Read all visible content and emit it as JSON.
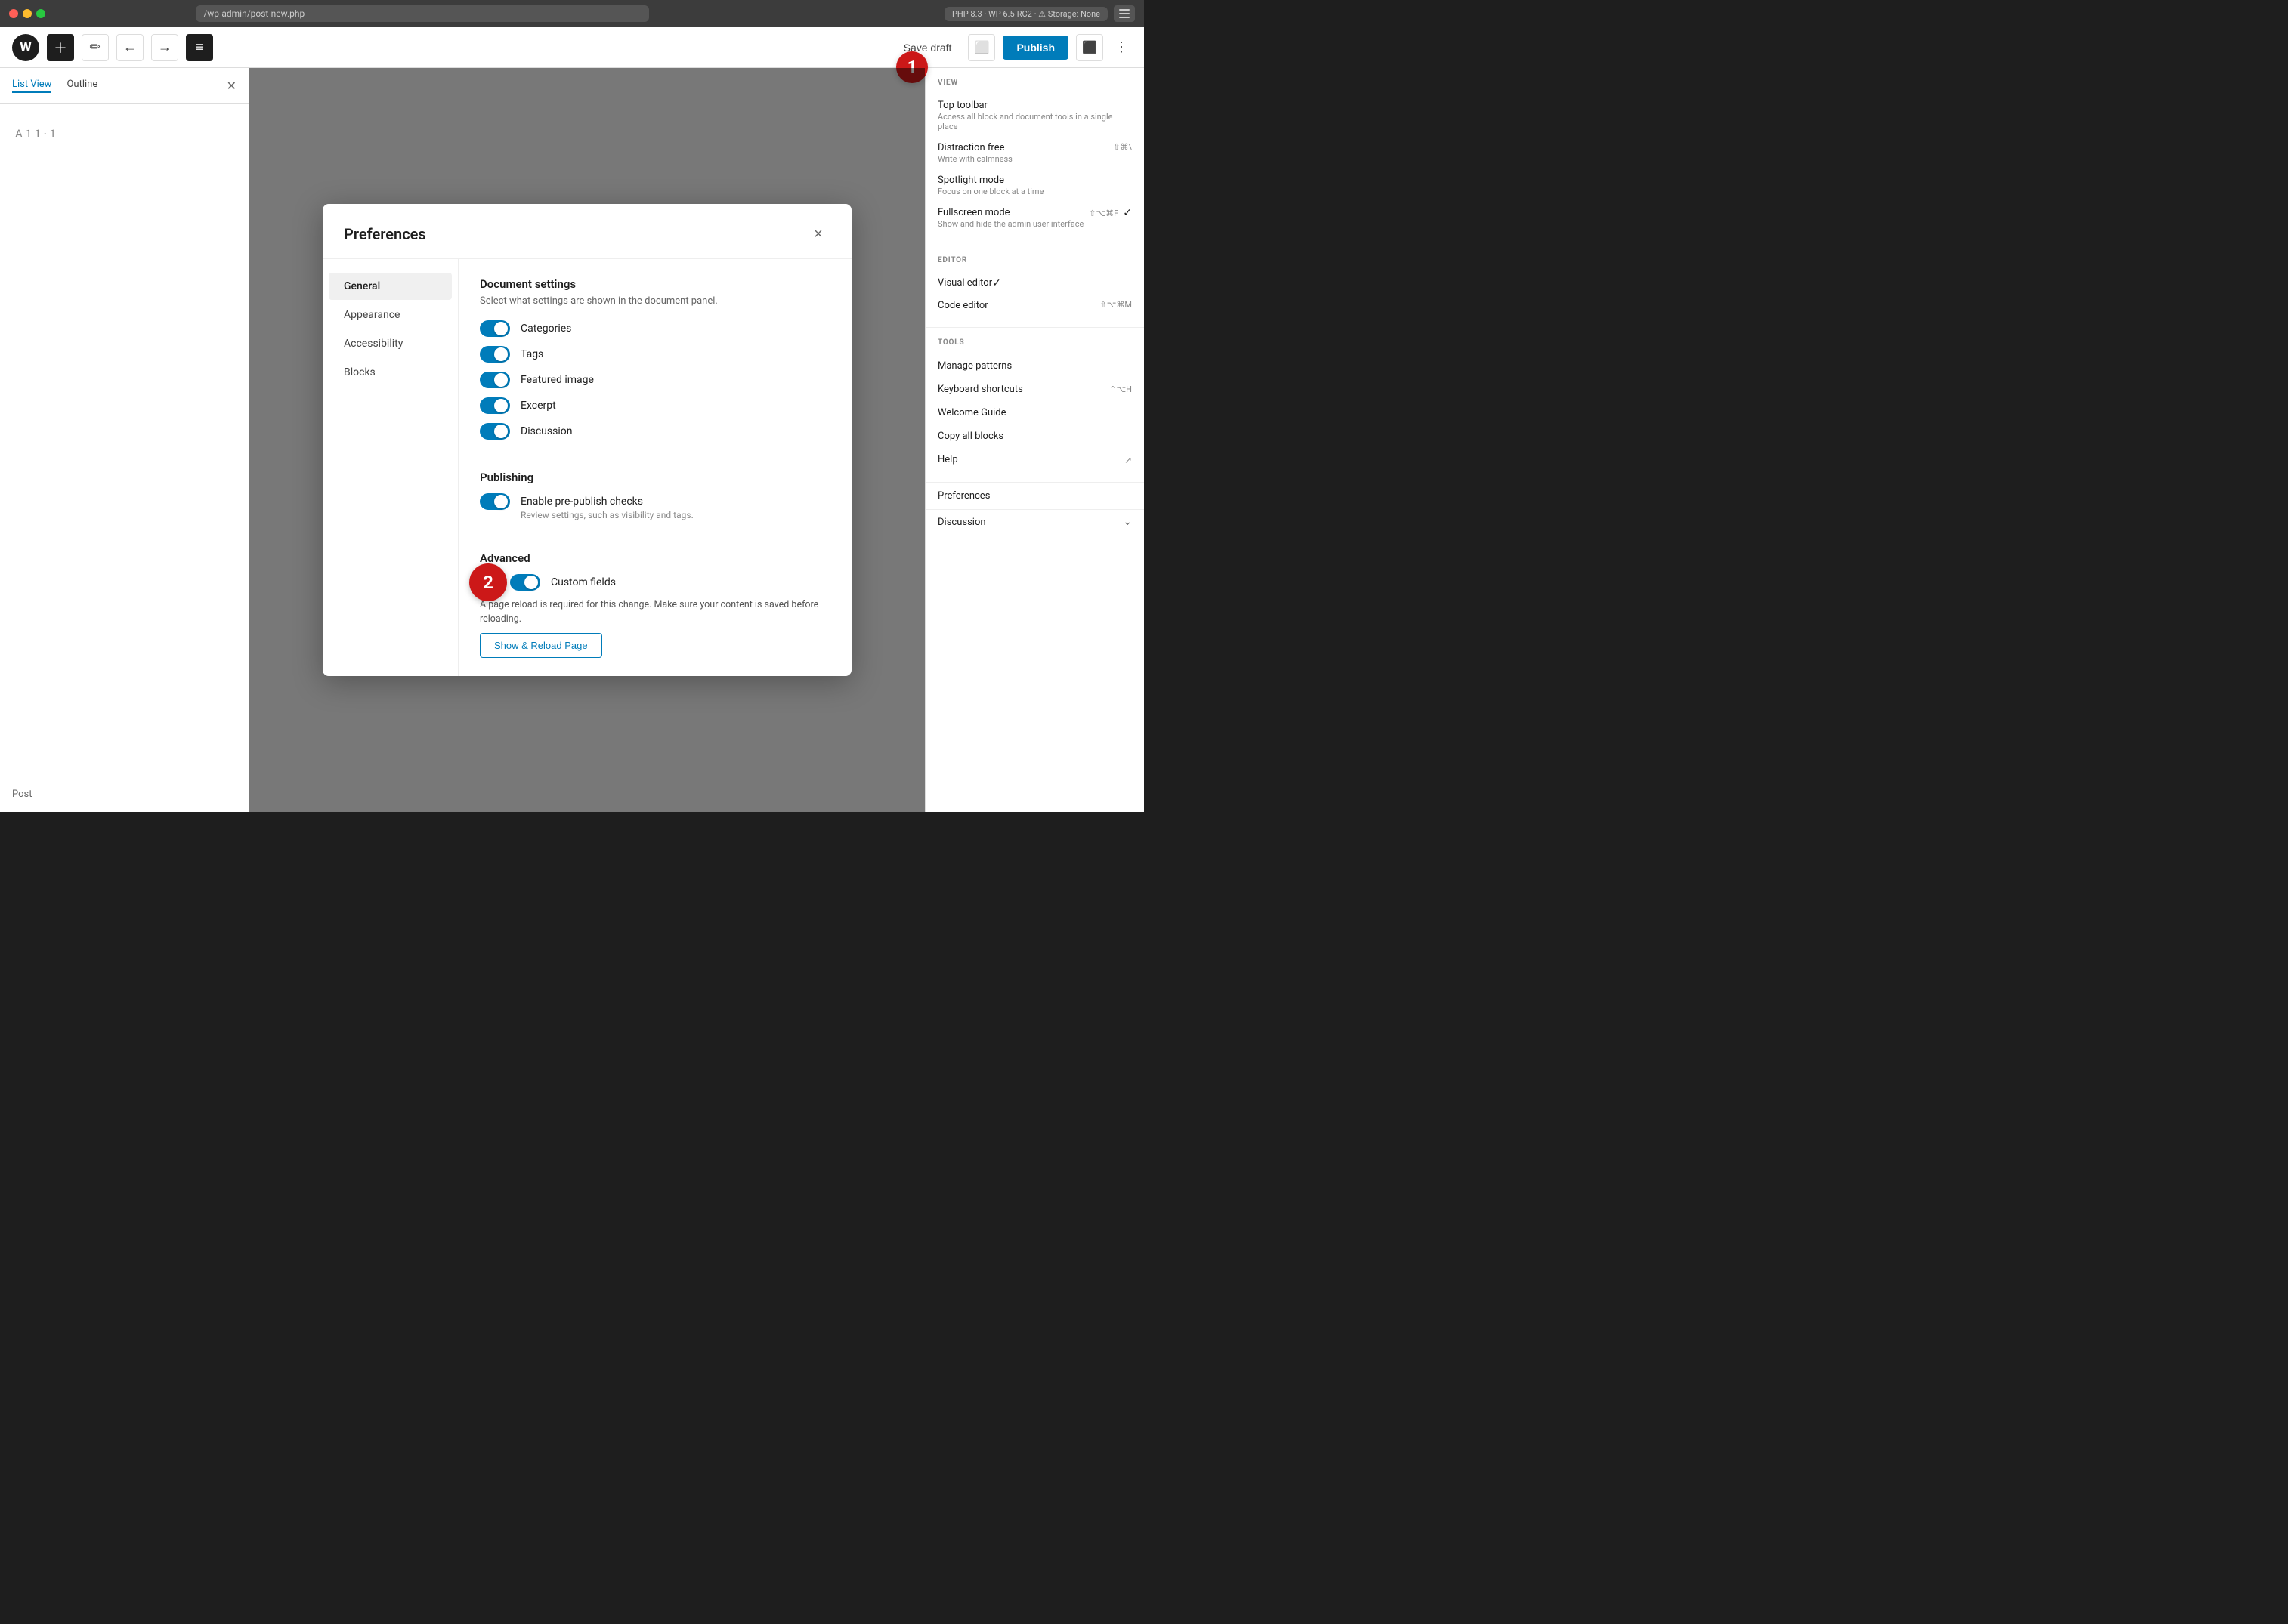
{
  "titlebar": {
    "url": "/wp-admin/post-new.php",
    "php_badge": "PHP 8.3 · WP 6.5-RC2 · ⚠ Storage: None"
  },
  "toolbar": {
    "save_draft": "Save draft",
    "publish": "Publish",
    "undo_title": "Undo",
    "redo_title": "Redo"
  },
  "left_panel": {
    "tab_list": "List View",
    "tab_outline": "Outline",
    "post_label": "Post"
  },
  "right_sidebar": {
    "view_section": "VIEW",
    "items_view": [
      {
        "title": "Top toolbar",
        "subtitle": "Access all block and document tools in a single place",
        "shortcut": ""
      },
      {
        "title": "Distraction free",
        "subtitle": "Write with calmness",
        "shortcut": "⇧⌘\\"
      },
      {
        "title": "Spotlight mode",
        "subtitle": "Focus on one block at a time",
        "shortcut": ""
      },
      {
        "title": "Fullscreen mode",
        "subtitle": "Show and hide the admin user interface",
        "shortcut": "⇧⌥⌘F"
      }
    ],
    "editor_section": "EDITOR",
    "items_editor": [
      {
        "title": "Visual editor",
        "checked": true,
        "shortcut": ""
      },
      {
        "title": "Code editor",
        "checked": false,
        "shortcut": "⇧⌥⌘M"
      }
    ],
    "tools_section": "TOOLS",
    "items_tools": [
      {
        "title": "Manage patterns",
        "external": false
      },
      {
        "title": "Keyboard shortcuts",
        "shortcut": "⌃⌥H"
      },
      {
        "title": "Welcome Guide",
        "external": false
      },
      {
        "title": "Copy all blocks",
        "external": false
      },
      {
        "title": "Help",
        "external": true
      }
    ],
    "preferences_label": "Preferences",
    "discussion_label": "Discussion"
  },
  "modal": {
    "title": "Preferences",
    "close_btn": "×",
    "nav_items": [
      "General",
      "Appearance",
      "Accessibility",
      "Blocks"
    ],
    "active_nav": "General",
    "doc_settings_title": "Document settings",
    "doc_settings_desc": "Select what settings are shown in the document panel.",
    "toggles": [
      {
        "label": "Categories",
        "on": true
      },
      {
        "label": "Tags",
        "on": true
      },
      {
        "label": "Featured image",
        "on": true
      },
      {
        "label": "Excerpt",
        "on": true
      },
      {
        "label": "Discussion",
        "on": true
      }
    ],
    "publishing_title": "Publishing",
    "publishing_toggle_label": "Enable pre-publish checks",
    "publishing_toggle_desc": "Review settings, such as visibility and tags.",
    "advanced_title": "Advanced",
    "custom_fields_label": "Custom fields",
    "reload_notice": "A page reload is required for this change. Make sure your content is saved before reloading.",
    "show_reload_btn": "Show & Reload Page"
  },
  "badges": {
    "badge1": "1",
    "badge2": "2"
  },
  "colors": {
    "blue": "#007cba",
    "red": "#cc1818",
    "toggle_on": "#007cba"
  }
}
